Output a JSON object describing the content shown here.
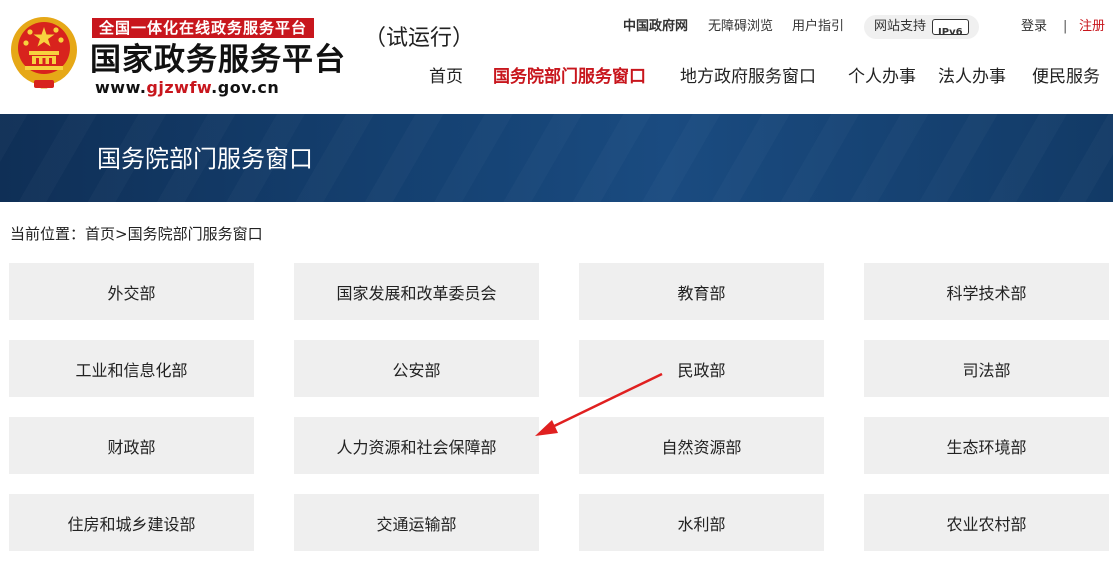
{
  "header": {
    "slogan": "全国一体化在线政务服务平台",
    "title": "国家政务服务平台",
    "url_prefix": "www.",
    "url_domain": "gjzwfw",
    "url_suffix": ".gov.cn",
    "trial": "（试运行）"
  },
  "toplinks": {
    "gov": "中国政府网",
    "accessible": "无障碍浏览",
    "guide": "用户指引",
    "ipv6_label": "网站支持",
    "ipv6_badge": "IPv6",
    "login": "登录",
    "separator": "|",
    "register": "注册"
  },
  "nav": {
    "items": [
      "首页",
      "国务院部门服务窗口",
      "地方政府服务窗口",
      "个人办事",
      "法人办事",
      "便民服务"
    ],
    "active_index": 1
  },
  "banner": {
    "title": "国务院部门服务窗口"
  },
  "breadcrumb": {
    "label": "当前位置：",
    "home": "首页",
    "sep": ">",
    "current": "国务院部门服务窗口"
  },
  "departments": [
    "外交部",
    "国家发展和改革委员会",
    "教育部",
    "科学技术部",
    "工业和信息化部",
    "公安部",
    "民政部",
    "司法部",
    "财政部",
    "人力资源和社会保障部",
    "自然资源部",
    "生态环境部",
    "住房和城乡建设部",
    "交通运输部",
    "水利部",
    "农业农村部"
  ],
  "colors": {
    "accent_red": "#c8161d",
    "banner_blue": "#154273",
    "tile_bg": "#efefef",
    "annotation_arrow": "#e02020"
  }
}
